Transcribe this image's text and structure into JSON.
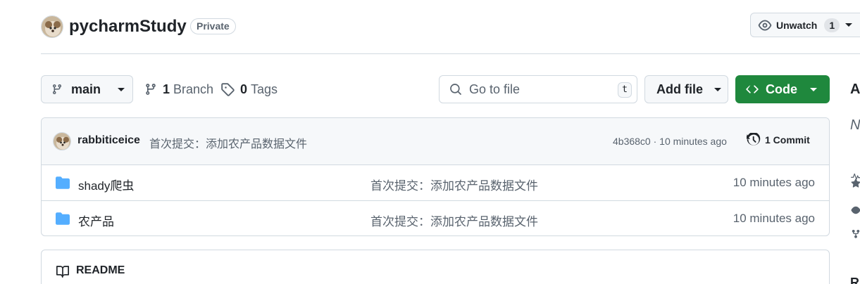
{
  "repo": {
    "name": "pycharmStudy",
    "visibility": "Private"
  },
  "watch": {
    "label": "Unwatch",
    "count": "1"
  },
  "toolbar": {
    "branch": "main",
    "branch_count": "1",
    "branch_label": "Branch",
    "tag_count": "0",
    "tag_label": "Tags",
    "search_placeholder": "Go to file",
    "search_shortcut": "t",
    "add_file_label": "Add file",
    "code_label": "Code"
  },
  "latest_commit": {
    "author": "rabbiticeice",
    "message": "首次提交：添加农产品数据文件",
    "meta": "4b368c0 · 10 minutes ago",
    "commit_count_label": "1 Commit"
  },
  "files": [
    {
      "name": "shady爬虫",
      "message": "首次提交：添加农产品数据文件",
      "time": "10 minutes ago"
    },
    {
      "name": "农产品",
      "message": "首次提交：添加农产品数据文件",
      "time": "10 minutes ago"
    }
  ],
  "readme": {
    "title": "README"
  },
  "sidebar": {
    "heading_fragment": "A",
    "description_fragment": "N",
    "partial_fragment": "R"
  },
  "colors": {
    "accent_green": "#1f883d",
    "folder_blue": "#54aeff",
    "border": "#d1d9e0",
    "muted_text": "#59636e"
  }
}
